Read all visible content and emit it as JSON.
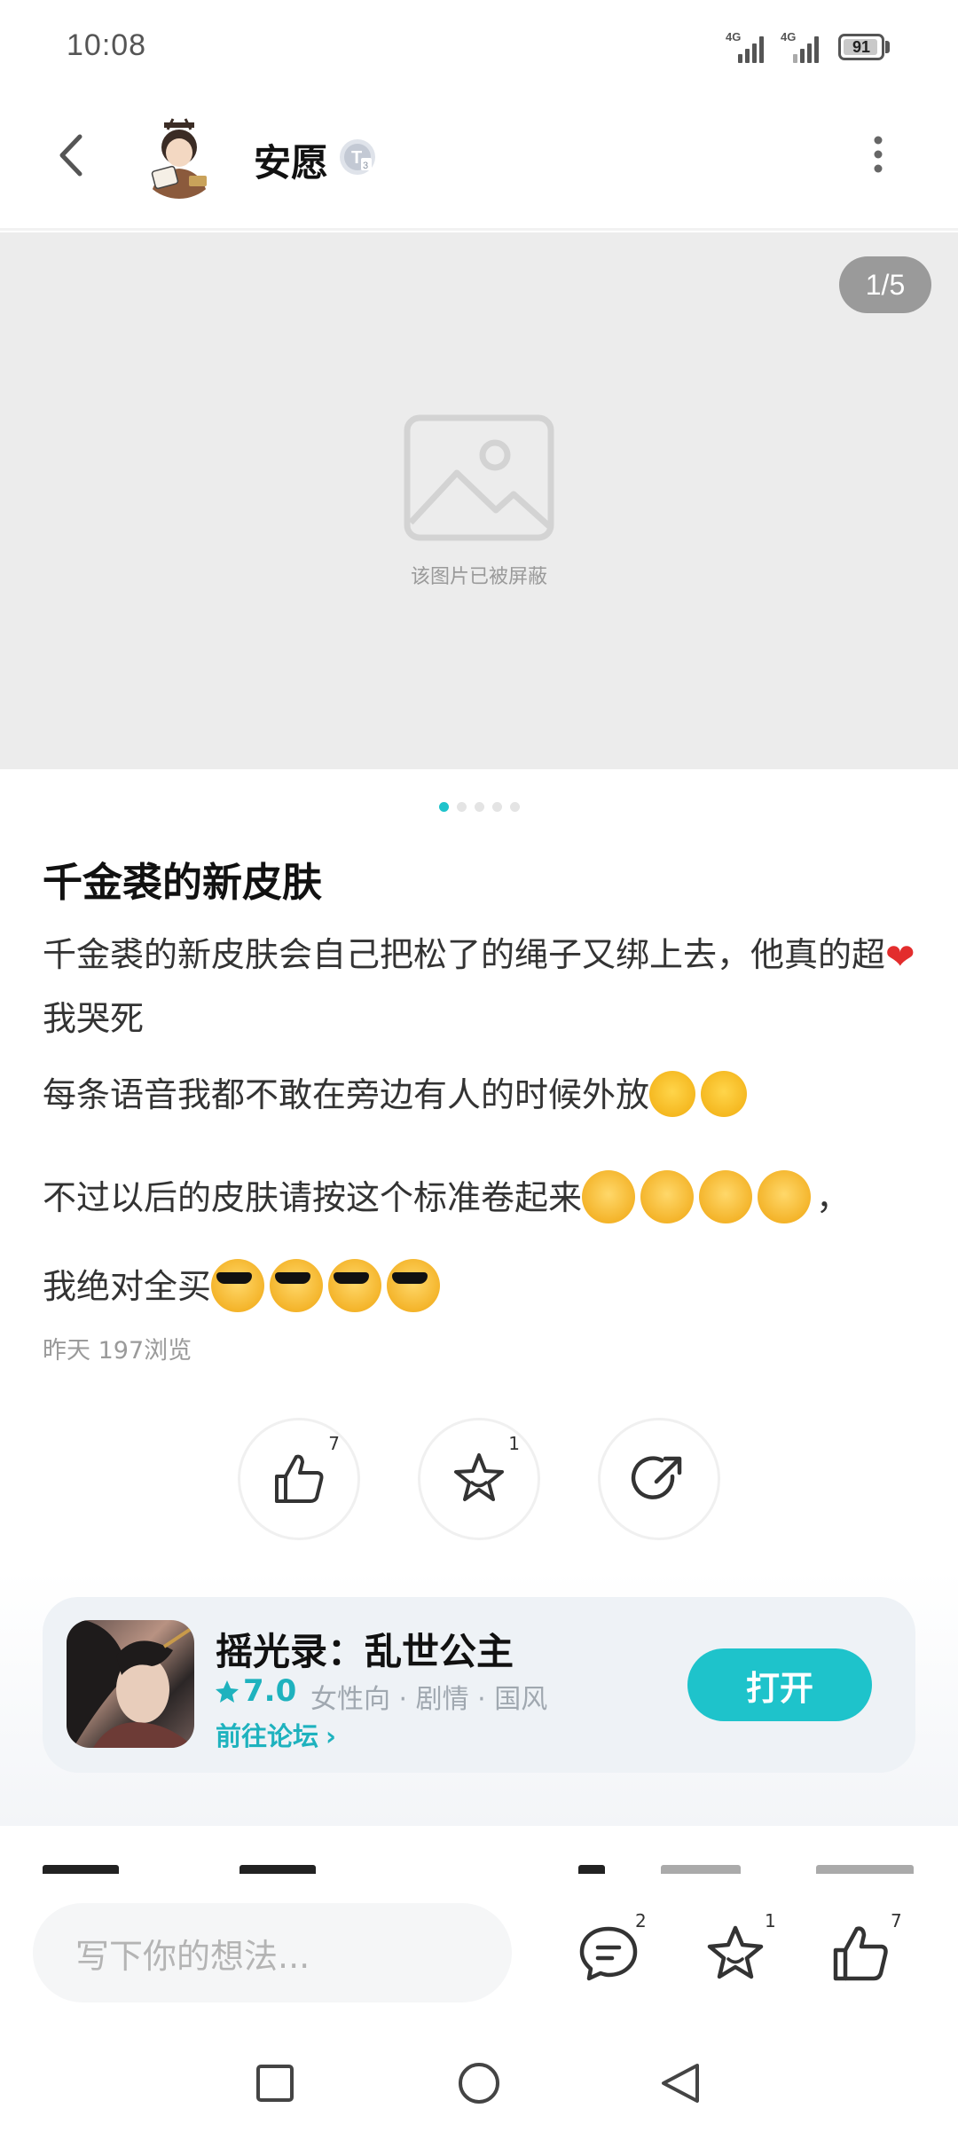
{
  "status_bar": {
    "time": "10:08",
    "network1": "4G",
    "network2": "4G",
    "battery": "91"
  },
  "header": {
    "username": "安愿",
    "badge": "T3"
  },
  "image_viewer": {
    "counter": "1/5",
    "blocked_text": "该图片已被屏蔽",
    "page_count": 5,
    "current_index": 0
  },
  "post": {
    "title": "千金裘的新皮肤",
    "p1a": "千金裘的新皮肤会自己把松了的绳子又绑上去，他真的超",
    "p1b": "我哭死",
    "p2": "每条语音我都不敢在旁边有人的时候外放",
    "p3a": "不过以后的皮肤请按这个标准卷起来",
    "p3b": "，",
    "p3c": "我绝对全买",
    "meta": "昨天   197浏览"
  },
  "actions": {
    "like_count": "7",
    "favorite_count": "1"
  },
  "game_card": {
    "name": "摇光录：乱世公主",
    "score": "7.0",
    "tags": "女性向  ·  剧情  ·  国风",
    "forum_link": "前往论坛",
    "open_button": "打开"
  },
  "bottom_bar": {
    "placeholder": "写下你的想法...",
    "comment_count": "2",
    "favorite_count": "1",
    "like_count": "7"
  },
  "colors": {
    "accent": "#1ec3cb",
    "accent_text": "#1eb2be"
  }
}
